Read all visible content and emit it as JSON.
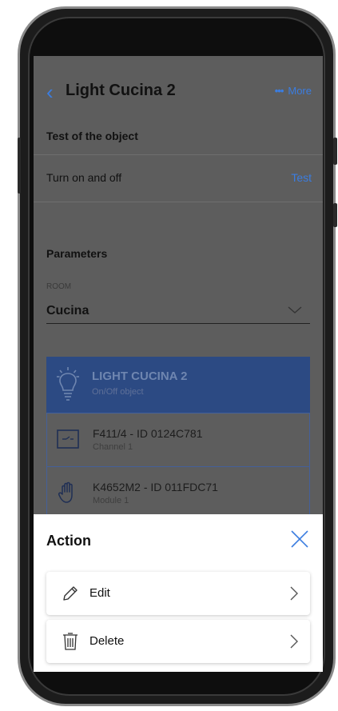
{
  "header": {
    "title": "Light Cucina 2",
    "more_label": "More"
  },
  "test_section": {
    "title": "Test of the object",
    "row_label": "Turn on and off",
    "row_action": "Test"
  },
  "parameters": {
    "title": "Parameters",
    "room_label": "ROOM",
    "room_value": "Cucina"
  },
  "object_card": {
    "name": "LIGHT CUCINA 2",
    "type": "On/Off object"
  },
  "devices": [
    {
      "name": "F411/4 - ID 0124C781",
      "detail": "Channel 1"
    },
    {
      "name": "K4652M2 - ID 011FDC71",
      "detail": "Module 1"
    }
  ],
  "action_sheet": {
    "title": "Action",
    "options": [
      {
        "label": "Edit"
      },
      {
        "label": "Delete"
      }
    ]
  },
  "colors": {
    "accent": "#3b7de0",
    "card": "#2c4a83"
  }
}
